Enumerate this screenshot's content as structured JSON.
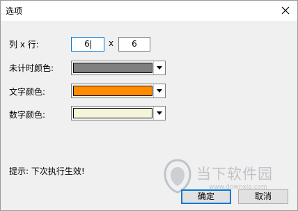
{
  "window": {
    "title": "选项",
    "close_icon": "close-icon"
  },
  "grid": {
    "label": "列 x 行:",
    "columns_value": "6",
    "separator": "x",
    "rows_value": "6"
  },
  "untimed_color": {
    "label": "未计时颜色:",
    "color": "#808080"
  },
  "text_color": {
    "label": "文字颜色:",
    "color": "#ff8c00"
  },
  "number_color": {
    "label": "数字颜色:",
    "color": "#f5f5dc"
  },
  "hint": "提示: 下次执行生效!",
  "buttons": {
    "ok": "确定",
    "cancel": "取消"
  },
  "watermark": {
    "logo": "downxia-logo",
    "name": "当下软件园",
    "url": "www.downxia.com"
  }
}
